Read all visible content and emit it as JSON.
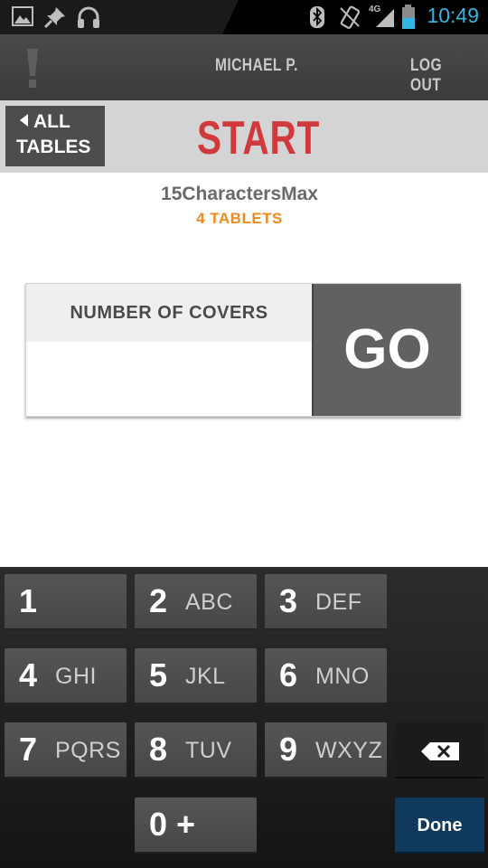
{
  "status_bar": {
    "time": "10:49",
    "network": "4G",
    "icons": [
      "image-icon",
      "pin-icon",
      "headphones-icon",
      "bluetooth-icon",
      "vibrate-icon",
      "signal-icon",
      "battery-icon"
    ],
    "accent_color": "#33b5e5"
  },
  "header": {
    "alert_icon": "exclamation-icon",
    "user_name": "MICHAEL P.",
    "logout_label": "LOG OUT"
  },
  "subheader": {
    "back_label_line1": "ALL",
    "back_label_line2": "TABLES",
    "title": "START",
    "title_color": "#d13a3c"
  },
  "table_info": {
    "name": "15CharactersMax",
    "tablets": "4 TABLETS",
    "tablets_color": "#f18a1e"
  },
  "covers_form": {
    "label": "NUMBER OF COVERS",
    "value": "",
    "go_label": "GO"
  },
  "keypad": {
    "keys": [
      {
        "num": "1",
        "letters": ""
      },
      {
        "num": "2",
        "letters": "ABC"
      },
      {
        "num": "3",
        "letters": "DEF"
      },
      {
        "num": "4",
        "letters": "GHI"
      },
      {
        "num": "5",
        "letters": "JKL"
      },
      {
        "num": "6",
        "letters": "MNO"
      },
      {
        "num": "7",
        "letters": "PQRS"
      },
      {
        "num": "8",
        "letters": "TUV"
      },
      {
        "num": "9",
        "letters": "WXYZ"
      },
      {
        "num": "0 +",
        "letters": ""
      }
    ],
    "backspace_icon": "backspace-icon",
    "done_label": "Done",
    "done_color": "#0f3a5e"
  }
}
